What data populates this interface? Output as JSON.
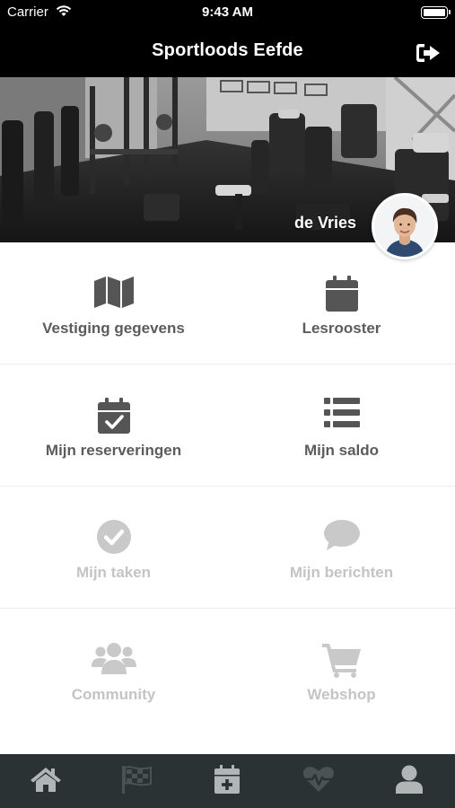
{
  "status_bar": {
    "carrier": "Carrier",
    "time": "9:43 AM"
  },
  "nav": {
    "title": "Sportloods Eefde",
    "logout_icon": "sign-out-icon"
  },
  "hero": {
    "user_name": "de Vries"
  },
  "menu": [
    {
      "label": "Vestiging gegevens",
      "icon": "map-icon",
      "enabled": true
    },
    {
      "label": "Lesrooster",
      "icon": "calendar-icon",
      "enabled": true
    },
    {
      "label": "Mijn reserveringen",
      "icon": "calendar-check-icon",
      "enabled": true
    },
    {
      "label": "Mijn saldo",
      "icon": "list-icon",
      "enabled": true
    },
    {
      "label": "Mijn taken",
      "icon": "check-circle-icon",
      "enabled": false
    },
    {
      "label": "Mijn berichten",
      "icon": "comment-icon",
      "enabled": false
    },
    {
      "label": "Community",
      "icon": "users-icon",
      "enabled": false
    },
    {
      "label": "Webshop",
      "icon": "shopping-cart-icon",
      "enabled": false
    }
  ],
  "tabbar": [
    {
      "icon": "home-icon",
      "active": true
    },
    {
      "icon": "checkered-flag-icon",
      "active": false
    },
    {
      "icon": "calendar-plus-icon",
      "active": true
    },
    {
      "icon": "heartbeat-icon",
      "active": false
    },
    {
      "icon": "user-icon",
      "active": true
    }
  ],
  "colors": {
    "header_bg": "#000000",
    "tile_text": "#5c5c5c",
    "tile_text_disabled": "#c4c4c4",
    "icon_active": "#555555",
    "icon_disabled": "#c9c9c9",
    "tabbar_bg": "#2b3234",
    "tab_active": "#b0b5b6",
    "tab_inactive": "#4a5254"
  }
}
